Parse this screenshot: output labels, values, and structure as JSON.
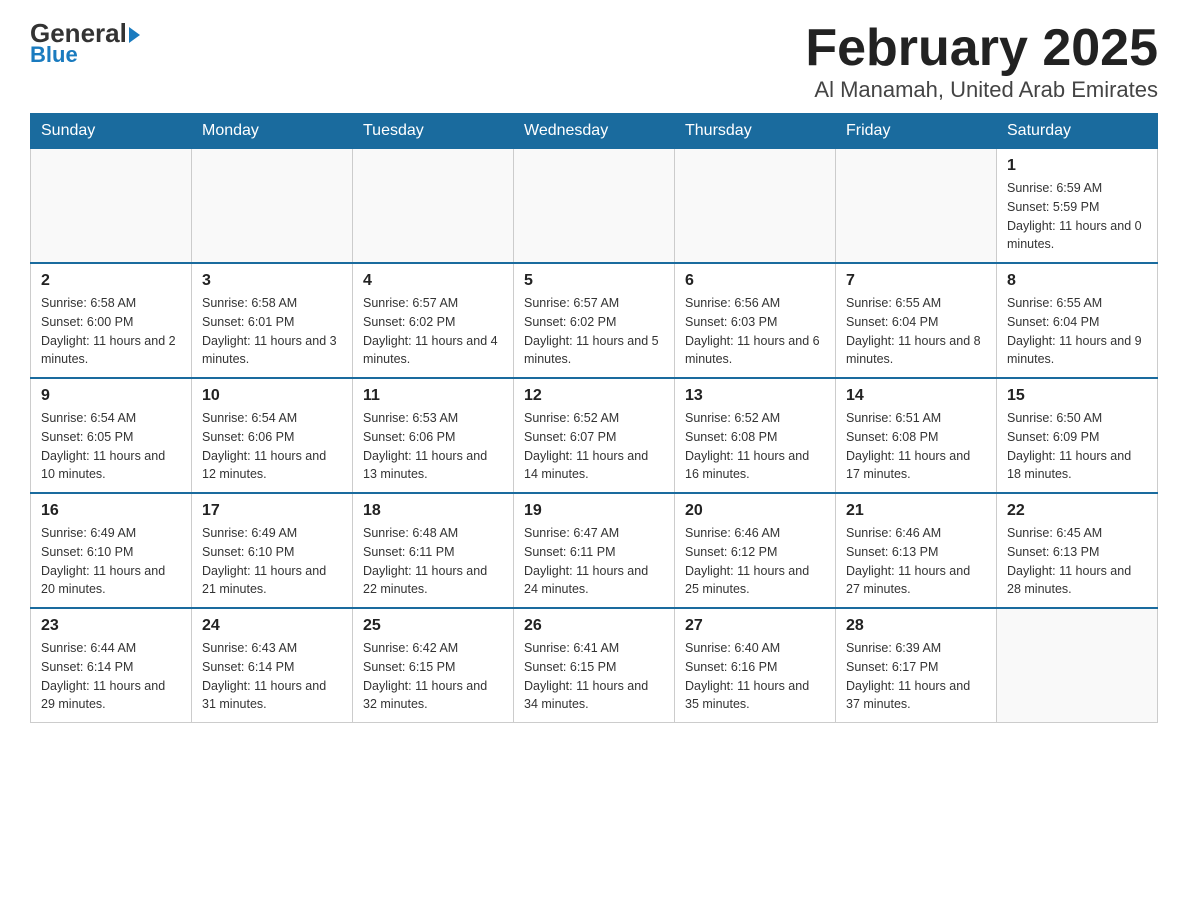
{
  "logo": {
    "general": "General",
    "blue": "Blue"
  },
  "title": "February 2025",
  "subtitle": "Al Manamah, United Arab Emirates",
  "days_of_week": [
    "Sunday",
    "Monday",
    "Tuesday",
    "Wednesday",
    "Thursday",
    "Friday",
    "Saturday"
  ],
  "weeks": [
    [
      {
        "day": "",
        "info": ""
      },
      {
        "day": "",
        "info": ""
      },
      {
        "day": "",
        "info": ""
      },
      {
        "day": "",
        "info": ""
      },
      {
        "day": "",
        "info": ""
      },
      {
        "day": "",
        "info": ""
      },
      {
        "day": "1",
        "info": "Sunrise: 6:59 AM\nSunset: 5:59 PM\nDaylight: 11 hours and 0 minutes."
      }
    ],
    [
      {
        "day": "2",
        "info": "Sunrise: 6:58 AM\nSunset: 6:00 PM\nDaylight: 11 hours and 2 minutes."
      },
      {
        "day": "3",
        "info": "Sunrise: 6:58 AM\nSunset: 6:01 PM\nDaylight: 11 hours and 3 minutes."
      },
      {
        "day": "4",
        "info": "Sunrise: 6:57 AM\nSunset: 6:02 PM\nDaylight: 11 hours and 4 minutes."
      },
      {
        "day": "5",
        "info": "Sunrise: 6:57 AM\nSunset: 6:02 PM\nDaylight: 11 hours and 5 minutes."
      },
      {
        "day": "6",
        "info": "Sunrise: 6:56 AM\nSunset: 6:03 PM\nDaylight: 11 hours and 6 minutes."
      },
      {
        "day": "7",
        "info": "Sunrise: 6:55 AM\nSunset: 6:04 PM\nDaylight: 11 hours and 8 minutes."
      },
      {
        "day": "8",
        "info": "Sunrise: 6:55 AM\nSunset: 6:04 PM\nDaylight: 11 hours and 9 minutes."
      }
    ],
    [
      {
        "day": "9",
        "info": "Sunrise: 6:54 AM\nSunset: 6:05 PM\nDaylight: 11 hours and 10 minutes."
      },
      {
        "day": "10",
        "info": "Sunrise: 6:54 AM\nSunset: 6:06 PM\nDaylight: 11 hours and 12 minutes."
      },
      {
        "day": "11",
        "info": "Sunrise: 6:53 AM\nSunset: 6:06 PM\nDaylight: 11 hours and 13 minutes."
      },
      {
        "day": "12",
        "info": "Sunrise: 6:52 AM\nSunset: 6:07 PM\nDaylight: 11 hours and 14 minutes."
      },
      {
        "day": "13",
        "info": "Sunrise: 6:52 AM\nSunset: 6:08 PM\nDaylight: 11 hours and 16 minutes."
      },
      {
        "day": "14",
        "info": "Sunrise: 6:51 AM\nSunset: 6:08 PM\nDaylight: 11 hours and 17 minutes."
      },
      {
        "day": "15",
        "info": "Sunrise: 6:50 AM\nSunset: 6:09 PM\nDaylight: 11 hours and 18 minutes."
      }
    ],
    [
      {
        "day": "16",
        "info": "Sunrise: 6:49 AM\nSunset: 6:10 PM\nDaylight: 11 hours and 20 minutes."
      },
      {
        "day": "17",
        "info": "Sunrise: 6:49 AM\nSunset: 6:10 PM\nDaylight: 11 hours and 21 minutes."
      },
      {
        "day": "18",
        "info": "Sunrise: 6:48 AM\nSunset: 6:11 PM\nDaylight: 11 hours and 22 minutes."
      },
      {
        "day": "19",
        "info": "Sunrise: 6:47 AM\nSunset: 6:11 PM\nDaylight: 11 hours and 24 minutes."
      },
      {
        "day": "20",
        "info": "Sunrise: 6:46 AM\nSunset: 6:12 PM\nDaylight: 11 hours and 25 minutes."
      },
      {
        "day": "21",
        "info": "Sunrise: 6:46 AM\nSunset: 6:13 PM\nDaylight: 11 hours and 27 minutes."
      },
      {
        "day": "22",
        "info": "Sunrise: 6:45 AM\nSunset: 6:13 PM\nDaylight: 11 hours and 28 minutes."
      }
    ],
    [
      {
        "day": "23",
        "info": "Sunrise: 6:44 AM\nSunset: 6:14 PM\nDaylight: 11 hours and 29 minutes."
      },
      {
        "day": "24",
        "info": "Sunrise: 6:43 AM\nSunset: 6:14 PM\nDaylight: 11 hours and 31 minutes."
      },
      {
        "day": "25",
        "info": "Sunrise: 6:42 AM\nSunset: 6:15 PM\nDaylight: 11 hours and 32 minutes."
      },
      {
        "day": "26",
        "info": "Sunrise: 6:41 AM\nSunset: 6:15 PM\nDaylight: 11 hours and 34 minutes."
      },
      {
        "day": "27",
        "info": "Sunrise: 6:40 AM\nSunset: 6:16 PM\nDaylight: 11 hours and 35 minutes."
      },
      {
        "day": "28",
        "info": "Sunrise: 6:39 AM\nSunset: 6:17 PM\nDaylight: 11 hours and 37 minutes."
      },
      {
        "day": "",
        "info": ""
      }
    ]
  ]
}
